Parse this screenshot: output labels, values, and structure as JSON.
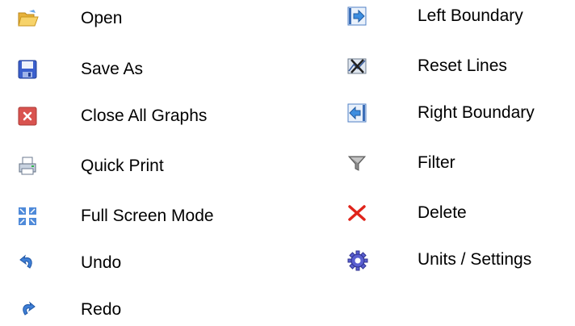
{
  "toolbar_legend": {
    "left_column": [
      {
        "icon": "folder-open-icon",
        "label": "Open"
      },
      {
        "icon": "floppy-disk-icon",
        "label": "Save As"
      },
      {
        "icon": "close-all-icon",
        "label": "Close All Graphs"
      },
      {
        "icon": "printer-icon",
        "label": "Quick Print"
      },
      {
        "icon": "fullscreen-icon",
        "label": "Full Screen Mode"
      },
      {
        "icon": "undo-icon",
        "label": "Undo"
      },
      {
        "icon": "redo-icon",
        "label": "Redo"
      }
    ],
    "right_column": [
      {
        "icon": "arrow-right-boundary-icon",
        "label": "Left Boundary"
      },
      {
        "icon": "reset-lines-icon",
        "label": "Reset Lines"
      },
      {
        "icon": "arrow-left-boundary-icon",
        "label": "Right Boundary"
      },
      {
        "icon": "filter-funnel-icon",
        "label": "Filter"
      },
      {
        "icon": "delete-x-icon",
        "label": "Delete"
      },
      {
        "icon": "gear-icon",
        "label": "Units / Settings"
      }
    ]
  }
}
